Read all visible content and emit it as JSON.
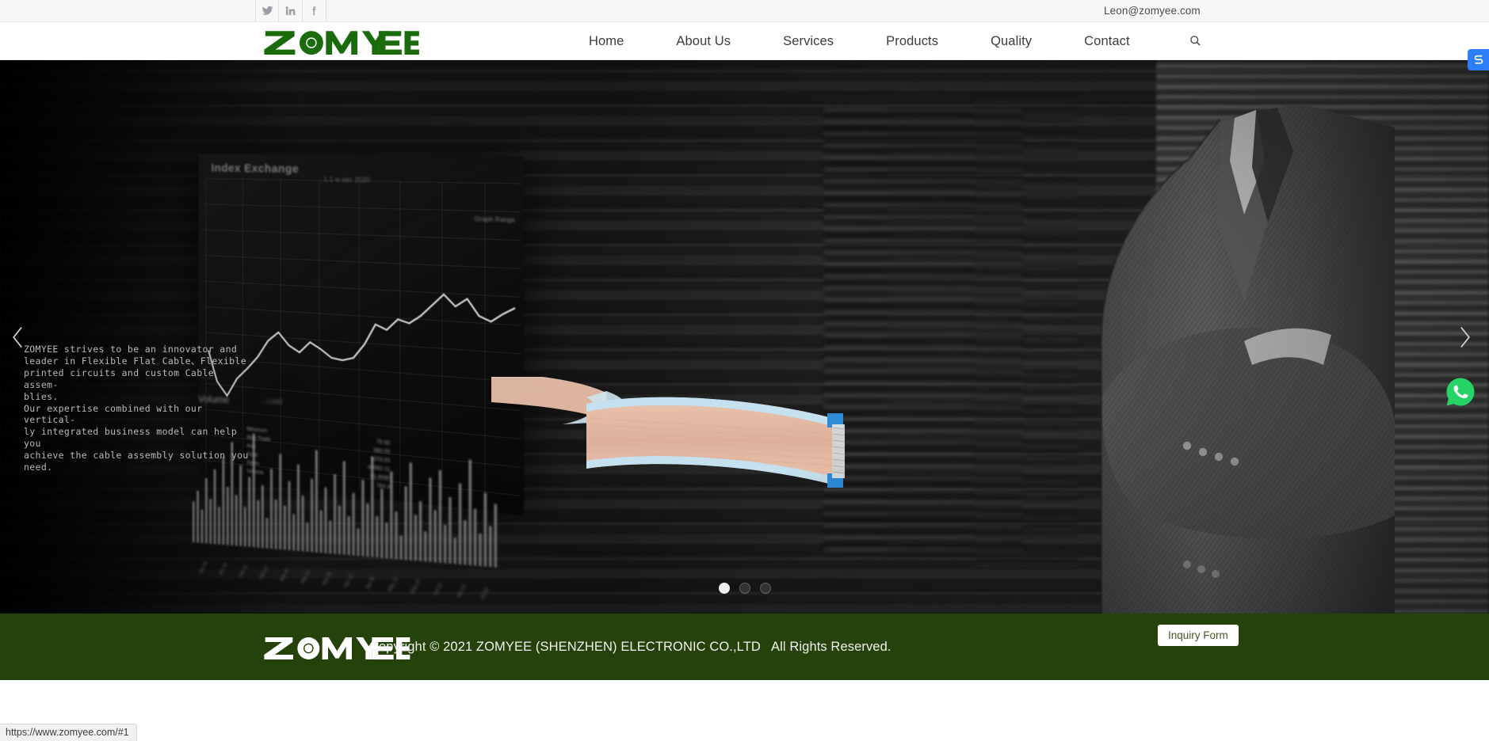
{
  "topbar": {
    "email": "Leon@zomyee.com",
    "social": [
      {
        "name": "twitter-icon",
        "label": "Twitter"
      },
      {
        "name": "linkedin-icon",
        "label": "LinkedIn"
      },
      {
        "name": "facebook-icon",
        "label": "Facebook"
      }
    ]
  },
  "header": {
    "logo_text": "ZOMYEE",
    "logo_color": "#1a6b0b",
    "nav": [
      {
        "label": "Home"
      },
      {
        "label": "About Us"
      },
      {
        "label": "Services"
      },
      {
        "label": "Products"
      },
      {
        "label": "Quality"
      },
      {
        "label": "Contact"
      }
    ],
    "search_icon": "search-icon"
  },
  "hero": {
    "caption": "ZOMYEE strives to be an innovator and\nleader in Flexible Flat Cable、Flexible\nprinted circuits and custom Cable assem-\nblies.\nOur expertise combined with our vertical-\nly integrated business model can help you\nachieve the cable assembly solution you\nneed.",
    "prev_arrow": "chevron-left-icon",
    "next_arrow": "chevron-right-icon",
    "slides_total": 3,
    "active_slide": 1,
    "monitor": {
      "title": "Index Exchange",
      "subtitle": "1.1 w sec 2020",
      "tag": "Graph Range",
      "table": [
        {
          "k": "Minimum",
          "v": "75.92"
        },
        {
          "k": "Max Trade",
          "v": "380.55"
        },
        {
          "k": "Ask",
          "v": "1073.05"
        },
        {
          "k": "Total",
          "v": "48562.11"
        },
        {
          "k": "Open",
          "v": "91.8090"
        },
        {
          "k": "Volume",
          "v": "783.4"
        }
      ],
      "volume_label": "Volume",
      "volume_sub": "- LOAD",
      "axis_labels": [
        "Jan 04",
        "Jan 18",
        "Feb 01",
        "Feb 15",
        "Mar 01",
        "Mar 15",
        "Mar 29",
        "Apr 12",
        "Apr 26",
        "May 10",
        "May 24",
        "Jun 07",
        "Jun 21",
        "Jul 05"
      ]
    }
  },
  "footer": {
    "logo_text": "ZOMYEE",
    "copyright": "Copyright © 2021 ZOMYEE (SHENZHEN) ELECTRONIC CO.,LTD   All Rights Reserved.",
    "background": "#24420a",
    "inquiry_label": "Inquiry Form"
  },
  "widgets": {
    "side_widget": "share-widget-icon",
    "whatsapp": "whatsapp-icon",
    "whatsapp_color": "#25D366",
    "side_widget_color": "#2d7ff9"
  },
  "statusbar": {
    "url": "https://www.zomyee.com/#1"
  }
}
